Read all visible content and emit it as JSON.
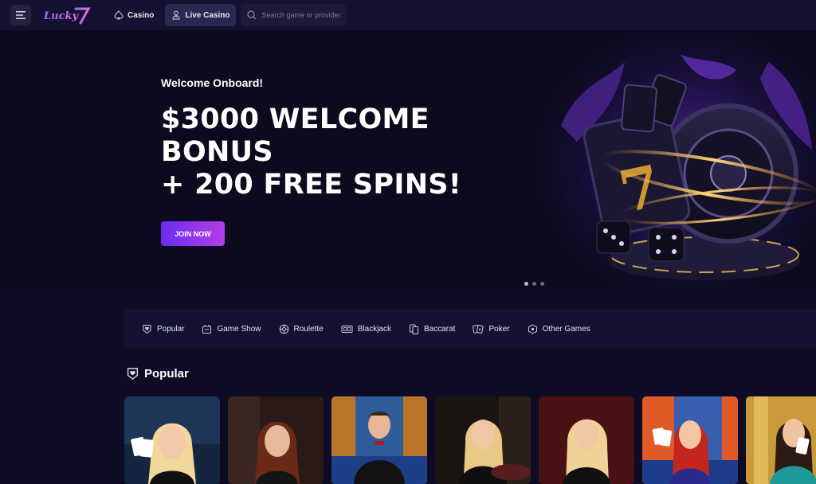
{
  "header": {
    "logo_text": "Lucky 7",
    "nav": [
      {
        "label": "Casino",
        "icon": "spade-icon"
      },
      {
        "label": "Live Casino",
        "icon": "dealer-icon",
        "active": true
      }
    ],
    "search": {
      "placeholder": "Search game or provider"
    }
  },
  "hero": {
    "kicker": "Welcome Onboard!",
    "title_lines": [
      "$3000 WELCOME",
      "BONUS",
      "+ 200 FREE SPINS!"
    ],
    "cta_label": "JOIN NOW",
    "slide_count": 3,
    "active_slide": 1
  },
  "categories": [
    {
      "label": "Popular",
      "icon": "heart-shield-icon"
    },
    {
      "label": "Game Show",
      "icon": "game-show-icon"
    },
    {
      "label": "Roulette",
      "icon": "roulette-icon"
    },
    {
      "label": "Blackjack",
      "icon": "blackjack-icon"
    },
    {
      "label": "Baccarat",
      "icon": "baccarat-icon"
    },
    {
      "label": "Poker",
      "icon": "poker-icon"
    },
    {
      "label": "Other Games",
      "icon": "other-games-icon"
    }
  ],
  "popular": {
    "title": "Popular",
    "game_count_visible": 7
  },
  "colors": {
    "background": "#0e0c24",
    "topbar": "#141230",
    "accent_start": "#6a2cf0",
    "accent_end": "#b240e6"
  }
}
